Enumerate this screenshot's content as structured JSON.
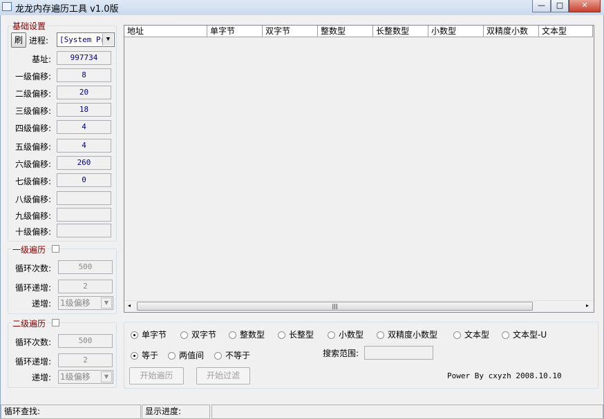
{
  "window": {
    "title": "龙龙内存遍历工具 v1.0版",
    "minimize": "—",
    "maximize": "□",
    "close": "✕"
  },
  "basic": {
    "group_label": "基础设置",
    "refresh_label": "刷",
    "process_label": "进程:",
    "process_value": "[System Pr…",
    "rows": [
      {
        "label": "基址:",
        "value": "997734"
      },
      {
        "label": "一级偏移:",
        "value": "8"
      },
      {
        "label": "二级偏移:",
        "value": "20"
      },
      {
        "label": "三级偏移:",
        "value": "18"
      },
      {
        "label": "四级偏移:",
        "value": "4"
      },
      {
        "label": "五级偏移:",
        "value": "4"
      },
      {
        "label": "六级偏移:",
        "value": "260"
      },
      {
        "label": "七级偏移:",
        "value": "0"
      },
      {
        "label": "八级偏移:",
        "value": ""
      },
      {
        "label": "九级偏移:",
        "value": ""
      },
      {
        "label": "十级偏移:",
        "value": ""
      }
    ]
  },
  "loop1": {
    "group_label": "一级遍历",
    "count_label": "循环次数:",
    "count_value": "500",
    "step_label": "循环递增:",
    "step_value": "2",
    "inc_label": "递增:",
    "inc_value": "1级偏移"
  },
  "loop2": {
    "group_label": "二级遍历",
    "count_label": "循环次数:",
    "count_value": "500",
    "step_label": "循环递增:",
    "step_value": "2",
    "inc_label": "递增:",
    "inc_value": "1级偏移"
  },
  "table": {
    "columns": [
      "地址",
      "单字节",
      "双字节",
      "整数型",
      "长整数型",
      "小数型",
      "双精度小数",
      "文本型"
    ]
  },
  "options": {
    "types": [
      {
        "label": "单字节",
        "checked": true
      },
      {
        "label": "双字节"
      },
      {
        "label": "整数型"
      },
      {
        "label": "长整型"
      },
      {
        "label": "小数型"
      },
      {
        "label": "双精度小数型"
      },
      {
        "label": "文本型"
      },
      {
        "label": "文本型-U"
      }
    ],
    "compare": [
      {
        "label": "等于",
        "checked": true
      },
      {
        "label": "两值间"
      },
      {
        "label": "不等于"
      }
    ],
    "range_label": "搜索范围:",
    "range_value": "",
    "start_traverse": "开始遍历",
    "start_filter": "开始过滤",
    "credit": "Power By cxyzh 2008.10.10"
  },
  "status": {
    "loop_find": "循环查找:",
    "progress": "显示进度:",
    "extra": ""
  }
}
